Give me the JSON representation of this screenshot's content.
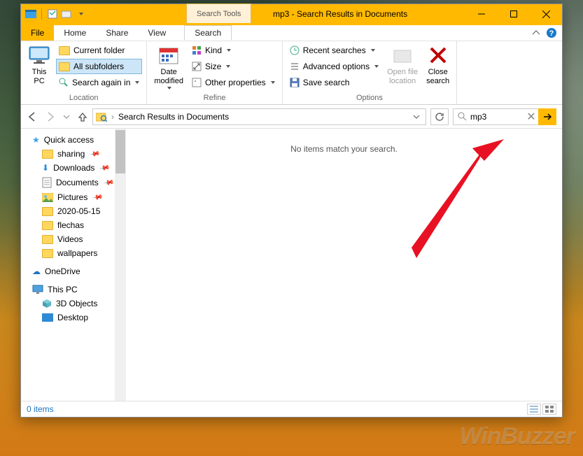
{
  "window": {
    "context_tab": "Search Tools",
    "title": "mp3 - Search Results in Documents"
  },
  "tabs": {
    "file": "File",
    "home": "Home",
    "share": "Share",
    "view": "View",
    "search": "Search"
  },
  "ribbon": {
    "location": {
      "this_pc": "This\nPC",
      "current_folder": "Current folder",
      "all_subfolders": "All subfolders",
      "search_again": "Search again in",
      "label": "Location"
    },
    "refine": {
      "date_modified": "Date\nmodified",
      "kind": "Kind",
      "size": "Size",
      "other_props": "Other properties",
      "label": "Refine"
    },
    "options": {
      "recent": "Recent searches",
      "advanced": "Advanced options",
      "save": "Save search",
      "open_loc": "Open file\nlocation",
      "close": "Close\nsearch",
      "label": "Options"
    }
  },
  "nav": {
    "breadcrumb": "Search Results in Documents"
  },
  "search": {
    "value": "mp3"
  },
  "tree": {
    "quick": "Quick access",
    "sharing": "sharing",
    "downloads": "Downloads",
    "documents": "Documents",
    "pictures": "Pictures",
    "d2020": "2020-05-15",
    "flechas": "flechas",
    "videos": "Videos",
    "wallpapers": "wallpapers",
    "onedrive": "OneDrive",
    "thispc": "This PC",
    "objects3d": "3D Objects",
    "desktop": "Desktop"
  },
  "content": {
    "empty": "No items match your search."
  },
  "status": {
    "count": "0 items"
  },
  "watermark": "WinBuzzer"
}
